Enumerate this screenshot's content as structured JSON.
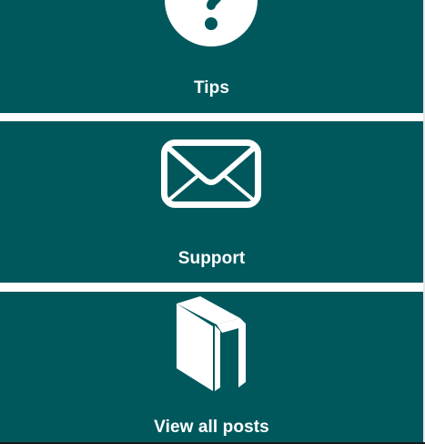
{
  "tiles": {
    "tips": {
      "label": "Tips",
      "icon": "question-circle-icon"
    },
    "support": {
      "label": "Support",
      "icon": "envelope-icon"
    },
    "posts": {
      "label": "View all posts",
      "icon": "book-icon"
    }
  },
  "colors": {
    "tile_background": "#00585d",
    "tile_foreground": "#ffffff",
    "separator": "#ffffff"
  }
}
